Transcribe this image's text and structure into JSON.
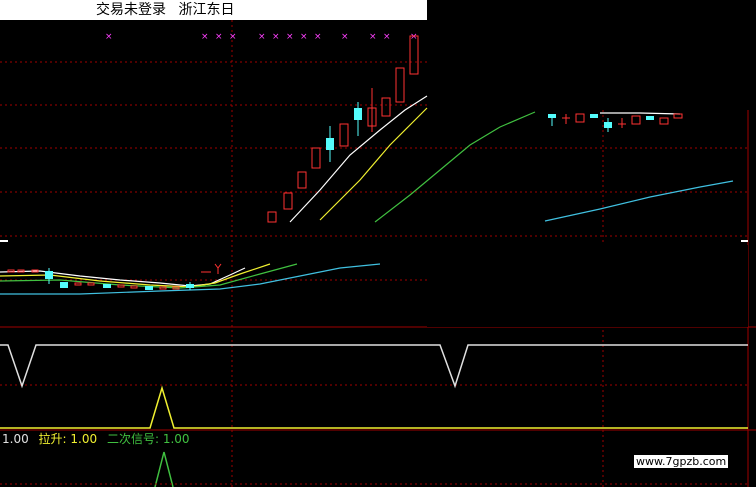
{
  "title": {
    "status": "交易未登录",
    "stock_name": "浙江东日"
  },
  "indicator": {
    "value_a": "1.00",
    "lift_label": "拉升:",
    "lift_value": "1.00",
    "second_signal_label": "二次信号:",
    "second_signal_value": "1.00"
  },
  "watermark": "www.7gpzb.com",
  "colors": {
    "background": "#000000",
    "up_candle": "#ff3232",
    "down_candle": "#54fcfc",
    "grid_red": "#a00000",
    "ma_white": "#ffffff",
    "ma_yellow": "#f0f030",
    "ma_green": "#40c040",
    "ma_cyan": "#40c0e0",
    "signal_marker": "#ff40ff",
    "lift_yellow": "#f0f030",
    "second_signal_green": "#40c040"
  }
}
